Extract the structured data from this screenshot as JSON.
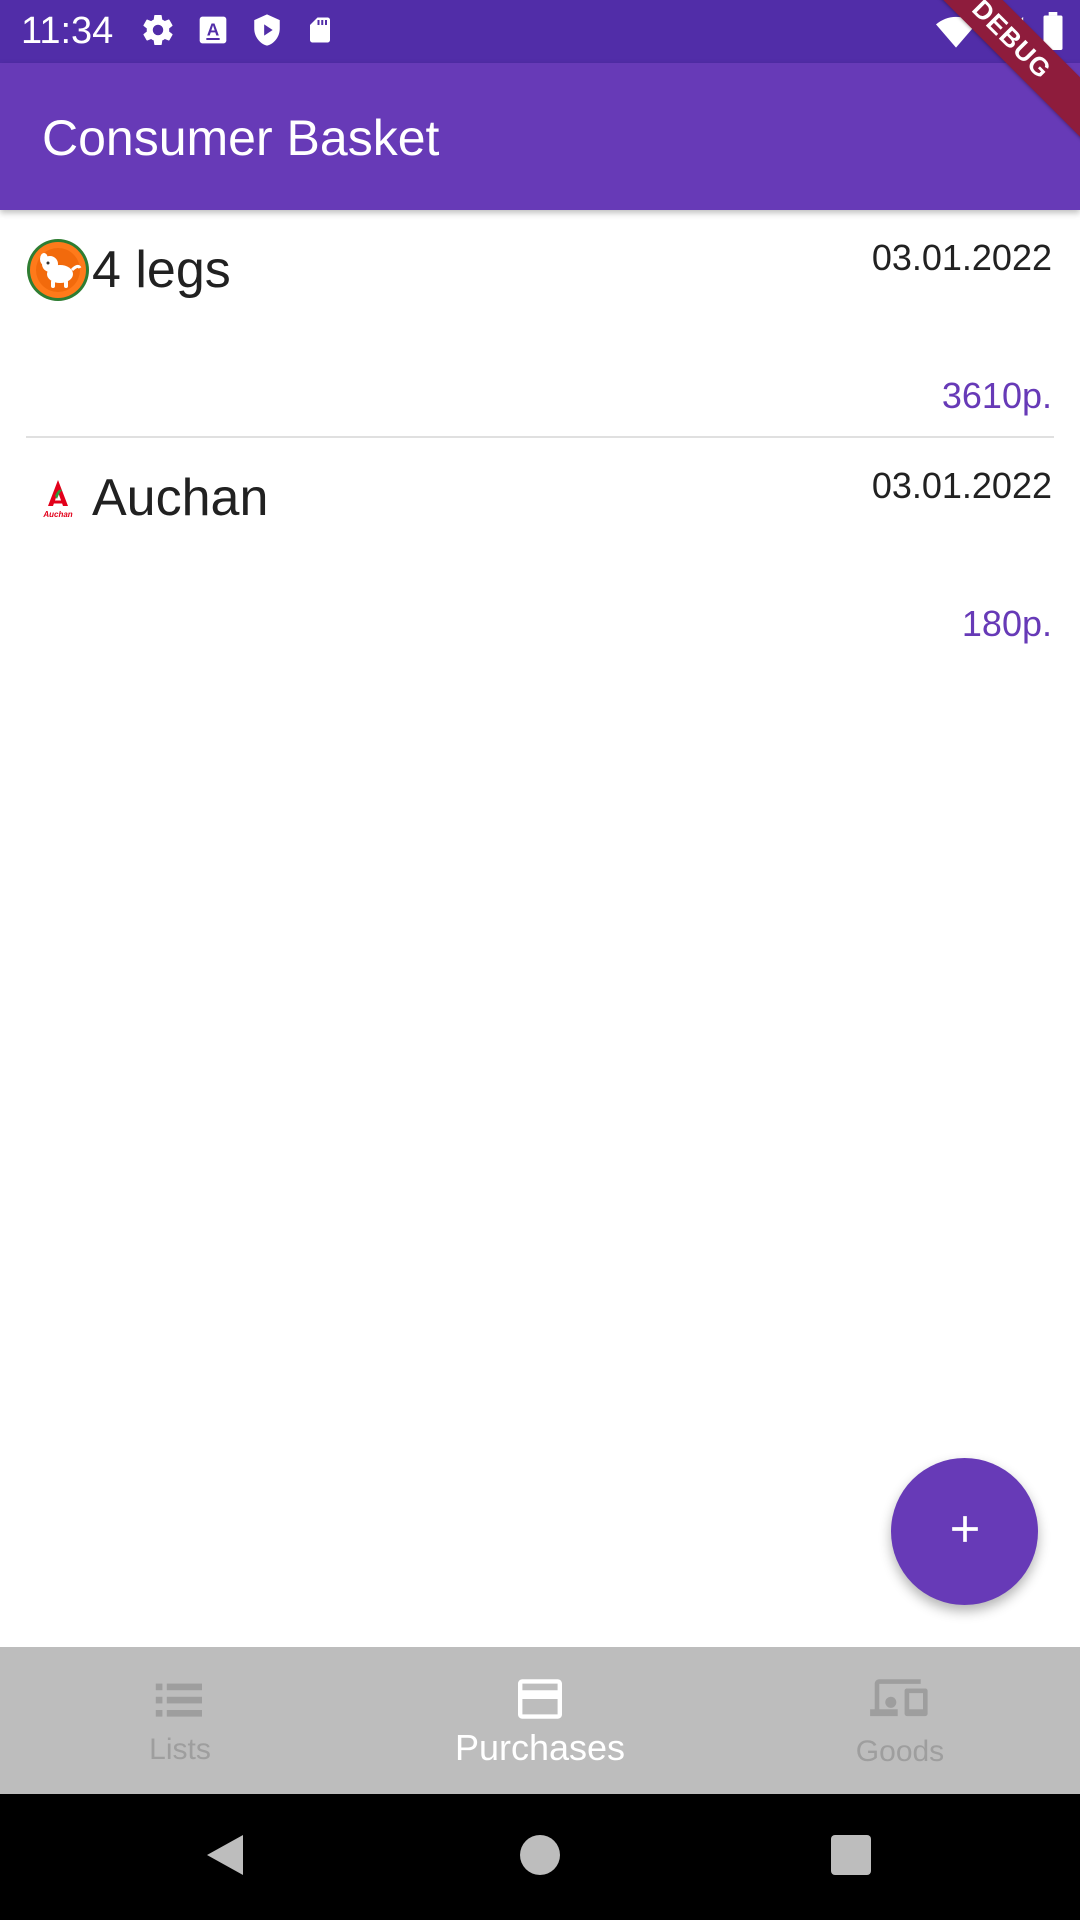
{
  "status_bar": {
    "time": "11:34",
    "icons_left": [
      "gear-icon",
      "keyboard-a-icon",
      "shield-play-icon",
      "sd-card-icon"
    ],
    "icons_right": [
      "wifi-icon",
      "cellular-signal-icon",
      "battery-icon"
    ]
  },
  "debug_banner": "DEBUG",
  "app_bar": {
    "title": "Consumer Basket"
  },
  "purchases": [
    {
      "store": "4 legs",
      "logo": "4-legs-logo",
      "date": "03.01.2022",
      "sum": "3610p."
    },
    {
      "store": "Auchan",
      "logo": "auchan-logo",
      "date": "03.01.2022",
      "sum": "180p."
    }
  ],
  "fab": {
    "icon": "plus-icon"
  },
  "bottom_nav": {
    "items": [
      {
        "label": "Lists",
        "icon": "list-icon",
        "active": false
      },
      {
        "label": "Purchases",
        "icon": "credit-card-icon",
        "active": true
      },
      {
        "label": "Goods",
        "icon": "devices-icon",
        "active": false
      }
    ]
  },
  "system_nav": {
    "icons": [
      "back-icon",
      "home-icon",
      "recents-icon"
    ]
  },
  "colors": {
    "primary": "#673ab7",
    "primary_dark": "#512da8",
    "debug": "#8e1c3c",
    "nav_background": "#bdbdbd",
    "nav_inactive": "#9e9e9e"
  }
}
